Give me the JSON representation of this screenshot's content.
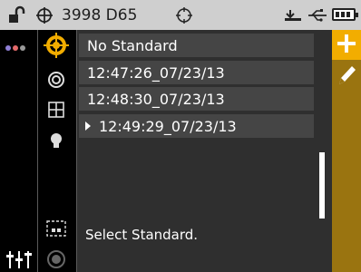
{
  "status_bar": {
    "title": "3998 D65",
    "icons": [
      "lock-open-icon",
      "crosshair-circle-icon",
      "target-icon",
      "device-icon",
      "usb-icon",
      "battery-icon"
    ]
  },
  "list": {
    "rows": [
      {
        "label": "No Standard",
        "selected": false
      },
      {
        "label": "12:47:26_07/23/13",
        "selected": false
      },
      {
        "label": "12:48:30_07/23/13",
        "selected": false
      },
      {
        "label": "12:49:29_07/23/13",
        "selected": true
      }
    ]
  },
  "status_message": "Select Standard.",
  "colors": {
    "accent": "#f2ad00",
    "accent_dark": "#9a7410",
    "row_bg": "#454545",
    "panel_bg": "#2f2f2f",
    "statusbar_bg": "#cfcfcf",
    "dot_purple": "#8f7fd6",
    "dot_red": "#e46a6a",
    "dot_gray": "#9a9a9a"
  },
  "sidebar": {
    "icons": [
      "target-gold-icon",
      "concentric-circle-icon",
      "grid-icon",
      "bulb-icon",
      "dashed-square-icon",
      "radio-circle-icon"
    ]
  },
  "left_column": {
    "icons": [
      "color-dots-icon",
      "sliders-icon"
    ]
  },
  "actions": {
    "icons": [
      "plus-icon",
      "pencil-icon"
    ]
  }
}
